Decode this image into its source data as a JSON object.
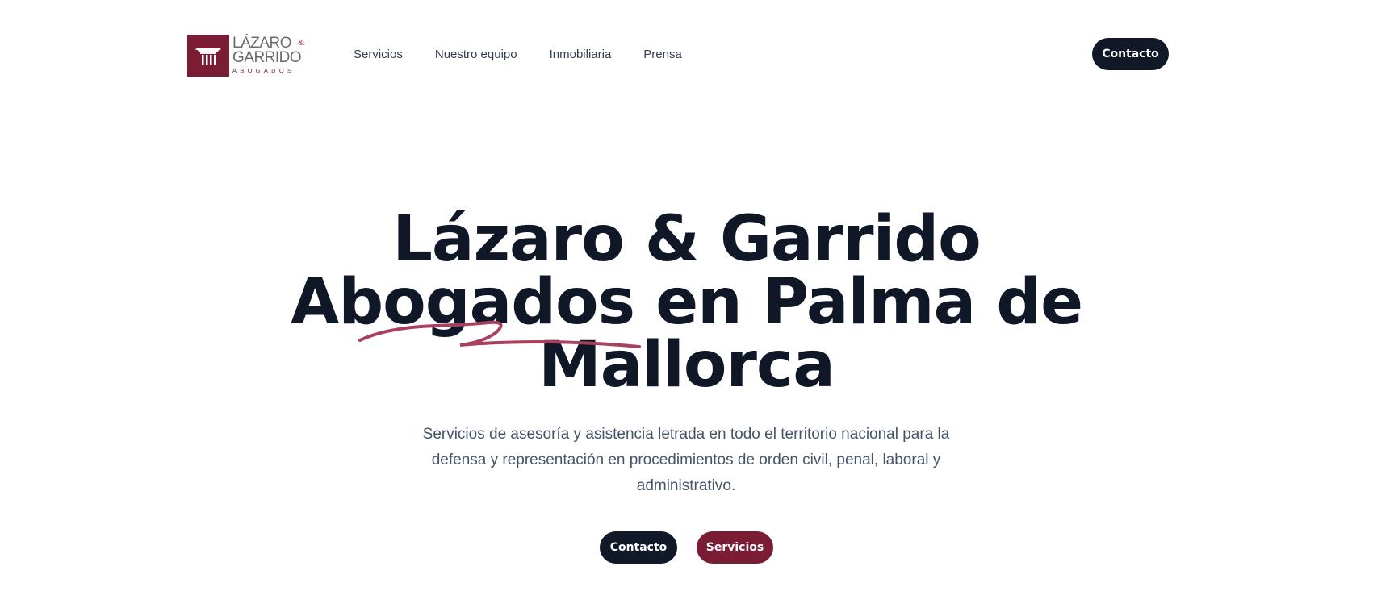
{
  "brand": {
    "line1": "LÁZARO",
    "ampersand": "&",
    "line2": "GARRIDO",
    "line3": "ABOGADOS",
    "color": "#7a1c34",
    "icon": "column-icon"
  },
  "nav": {
    "items": [
      {
        "label": "Servicios"
      },
      {
        "label": "Nuestro equipo"
      },
      {
        "label": "Inmobiliaria"
      },
      {
        "label": "Prensa"
      }
    ],
    "contact_label": "Contacto"
  },
  "hero": {
    "title_line1": "Lázaro & Garrido",
    "title_line2": "Abogados en Palma de",
    "title_line3": "Mallorca",
    "subtitle": "Servicios de asesoría y asistencia letrada en todo el territorio nacional para la defensa y representación en procedimientos de orden civil, penal, laboral y administrativo.",
    "primary_button": "Contacto",
    "secondary_button": "Servicios"
  },
  "colors": {
    "dark": "#111827",
    "accent": "#7a1c34",
    "swoosh": "#a8405e"
  }
}
